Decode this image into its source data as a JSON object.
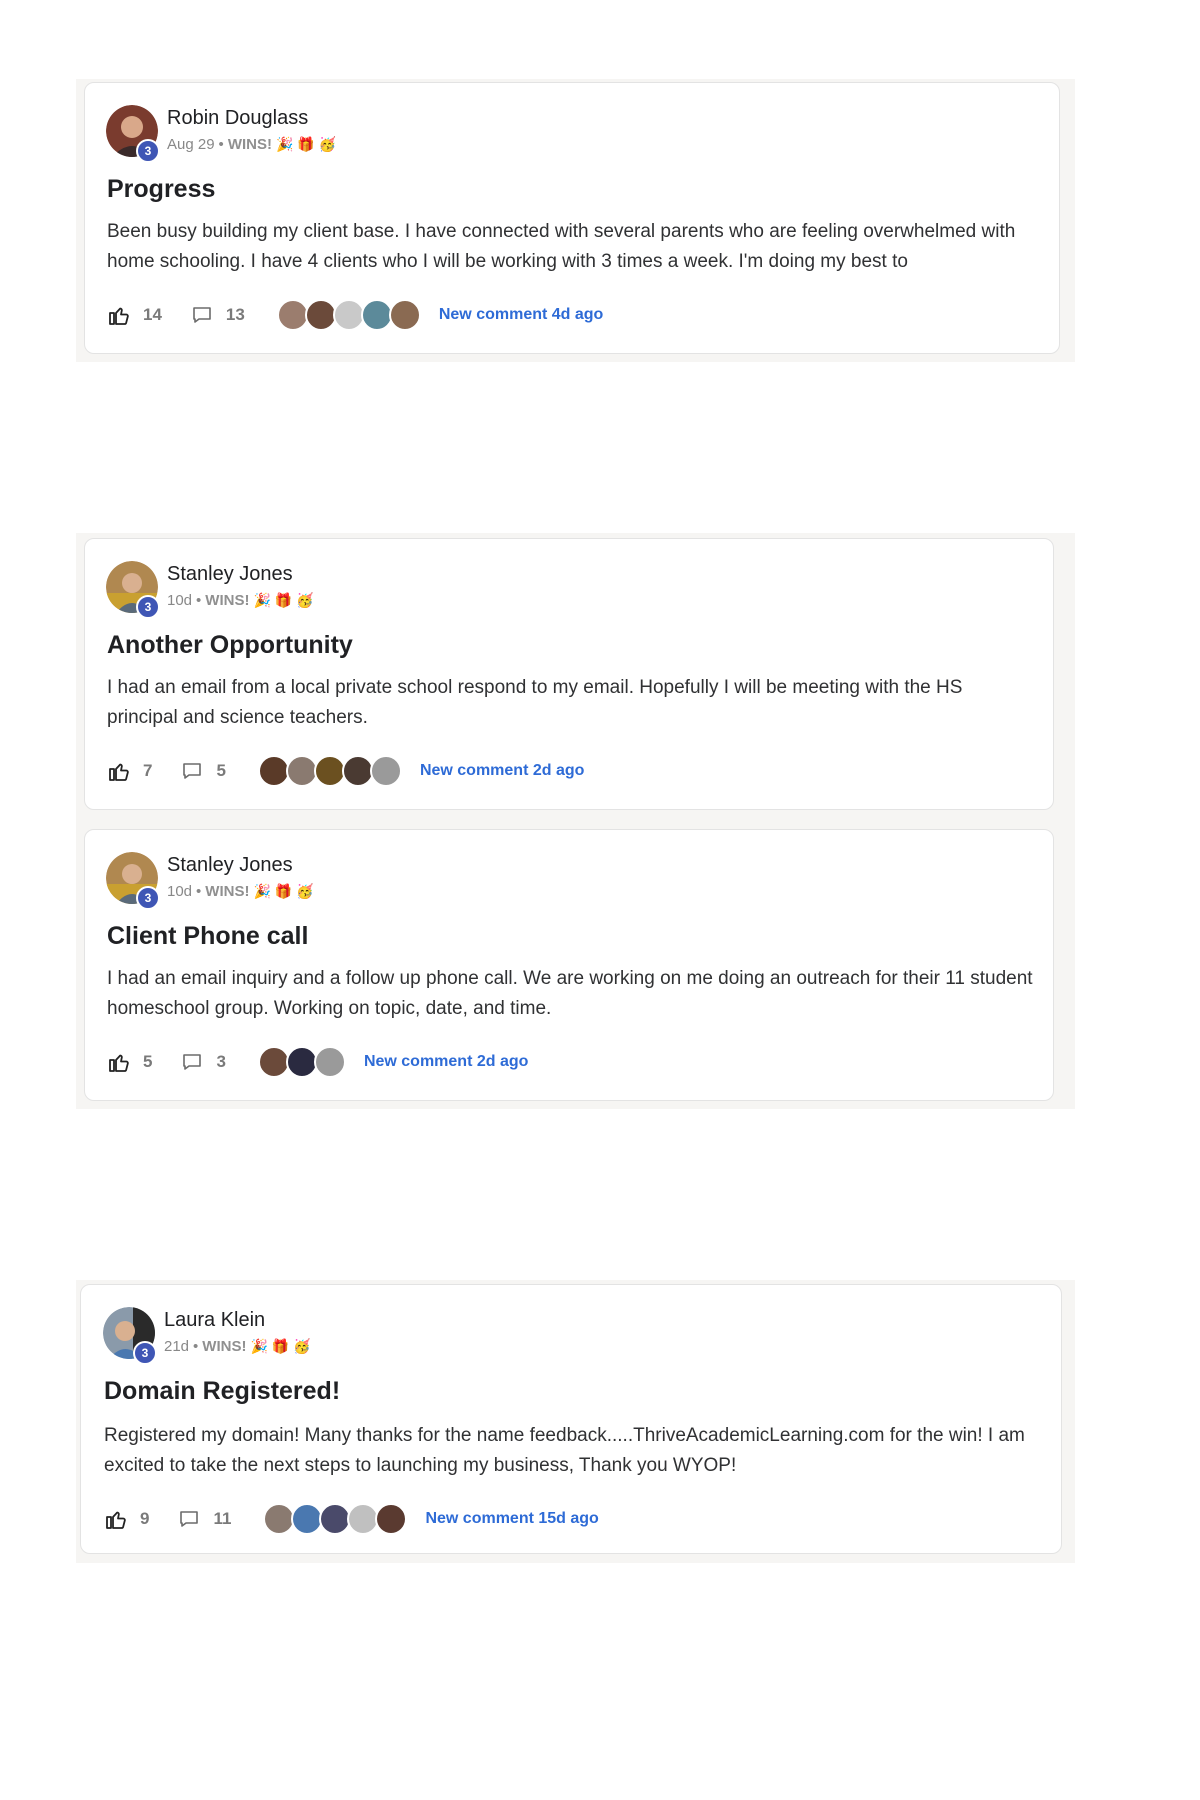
{
  "posts": [
    {
      "author": "Robin Douglass",
      "level": "3",
      "date": "Aug 29",
      "separator": "•",
      "category": "WINS!",
      "emojis": "🎉 🎁 🥳",
      "title": "Progress",
      "body": "Been busy building my client base. I have connected with several parents who are feeling overwhelmed with home schooling. I have 4 clients who I will be working with 3 times a week. I'm doing my best to",
      "likes": "14",
      "comments": "13",
      "new_comment": "New comment 4d ago",
      "avatar_color": "#7a3b2e",
      "commenter_colors": [
        "#9b7d6e",
        "#6b4a3a",
        "#c9c9c9",
        "#5c8a9a",
        "#8a6a52"
      ]
    },
    {
      "author": "Stanley Jones",
      "level": "3",
      "date": "10d",
      "separator": "•",
      "category": "WINS!",
      "emojis": "🎉 🎁 🥳",
      "title": "Another Opportunity",
      "body": "I had an email from a local private school respond to my email. Hopefully I will be meeting with the HS principal and science teachers.",
      "likes": "7",
      "comments": "5",
      "new_comment": "New comment 2d ago",
      "avatar_color": "#b08850",
      "commenter_colors": [
        "#5a3a28",
        "#8a7a70",
        "#6b5020",
        "#4a3a32",
        "#9a9a9a"
      ]
    },
    {
      "author": "Stanley Jones",
      "level": "3",
      "date": "10d",
      "separator": "•",
      "category": "WINS!",
      "emojis": "🎉 🎁 🥳",
      "title": "Client Phone call",
      "body": "I had an email inquiry and a follow up phone call. We are working on me doing an outreach for their 11 student homeschool group. Working on topic, date, and time.",
      "likes": "5",
      "comments": "3",
      "new_comment": "New comment 2d ago",
      "avatar_color": "#b08850",
      "commenter_colors": [
        "#6b4a3a",
        "#2a2a40",
        "#9a9a9a"
      ]
    },
    {
      "author": "Laura Klein",
      "level": "3",
      "date": "21d",
      "separator": "•",
      "category": "WINS!",
      "emojis": "🎉 🎁 🥳",
      "title": "Domain Registered!",
      "body": "Registered my domain! Many thanks for the name feedback.....ThriveAcademicLearning.com for the win! I am excited to take the next steps to launching my business, Thank you WYOP!",
      "likes": "9",
      "comments": "11",
      "new_comment": "New comment 15d ago",
      "avatar_color": "#5a7a9a",
      "commenter_colors": [
        "#8a7a70",
        "#4a78b0",
        "#4a4a6a",
        "#c0c0c0",
        "#5a3a30"
      ]
    }
  ]
}
